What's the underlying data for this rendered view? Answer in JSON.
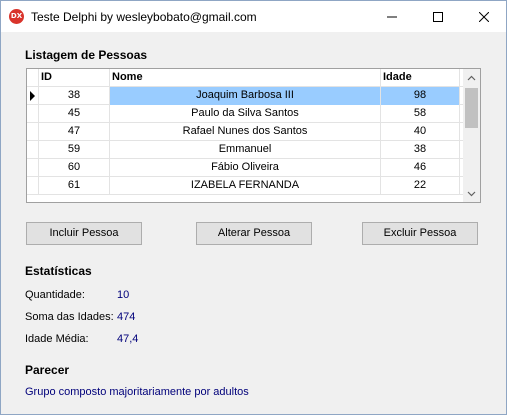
{
  "window": {
    "title": "Teste Delphi by wesleybobato@gmail.com",
    "icon_text": "DX",
    "icon_color": "#d9342b"
  },
  "list": {
    "title": "Listagem de Pessoas",
    "columns": [
      "ID",
      "Nome",
      "Idade"
    ],
    "rows": [
      {
        "id": "38",
        "nome": "Joaquim Barbosa III",
        "idade": "98"
      },
      {
        "id": "45",
        "nome": "Paulo da Silva Santos",
        "idade": "58"
      },
      {
        "id": "47",
        "nome": "Rafael Nunes dos Santos",
        "idade": "40"
      },
      {
        "id": "59",
        "nome": "Emmanuel",
        "idade": "38"
      },
      {
        "id": "60",
        "nome": "Fábio Oliveira",
        "idade": "46"
      },
      {
        "id": "61",
        "nome": "IZABELA FERNANDA",
        "idade": "22"
      }
    ],
    "selected_color": "#99ccff"
  },
  "buttons": {
    "incluir": "Incluir Pessoa",
    "alterar": "Alterar Pessoa",
    "excluir": "Excluir Pessoa"
  },
  "stats": {
    "title": "Estatísticas",
    "quantidade_label": "Quantidade:",
    "quantidade_value": "10",
    "soma_label": "Soma das Idades:",
    "soma_value": "474",
    "media_label": "Idade Média:",
    "media_value": "47,4",
    "value_color": "#00007a"
  },
  "parecer": {
    "title": "Parecer",
    "text": "Grupo composto majoritariamente por adultos"
  }
}
